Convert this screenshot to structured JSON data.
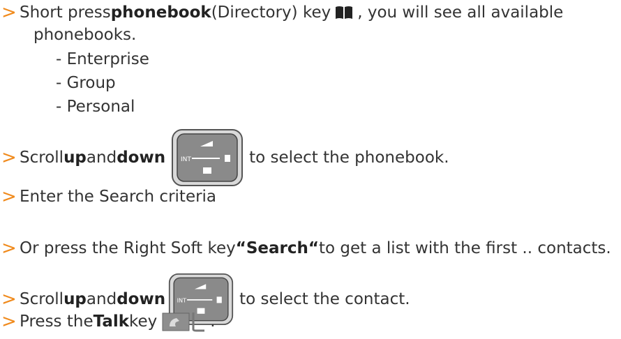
{
  "step1": {
    "pre": "Short press ",
    "bold": "phonebook",
    "post": " (Directory) key",
    "tail": ", you will see all available",
    "cont": "phonebooks.",
    "icon": "book-icon",
    "items": [
      "- Enterprise",
      "- Group",
      "- Personal"
    ]
  },
  "step2": {
    "pre": "Scroll ",
    "b1": "up",
    "mid": " and ",
    "b2": "down",
    "post": "to select the phonebook.",
    "icon": "nav-key-icon"
  },
  "step3": {
    "text": "Enter the Search criteria"
  },
  "step4": {
    "pre": "Or press the Right Soft key ",
    "bold": "“Search“",
    "post": " to get a list with the first .. contacts."
  },
  "step5": {
    "pre": "Scroll ",
    "b1": "up",
    "mid": " and ",
    "b2": "down",
    "post": "to select the contact.",
    "icon": "nav-key-icon"
  },
  "step6": {
    "pre": "Press the ",
    "bold": "Talk",
    "post": " key",
    "tail": ".",
    "icon": "talk-key-icon"
  },
  "nav_key_labels": {
    "left": "INT"
  },
  "colors": {
    "arrow": "#f08a1c",
    "text": "#333333"
  },
  "bullet": ">"
}
